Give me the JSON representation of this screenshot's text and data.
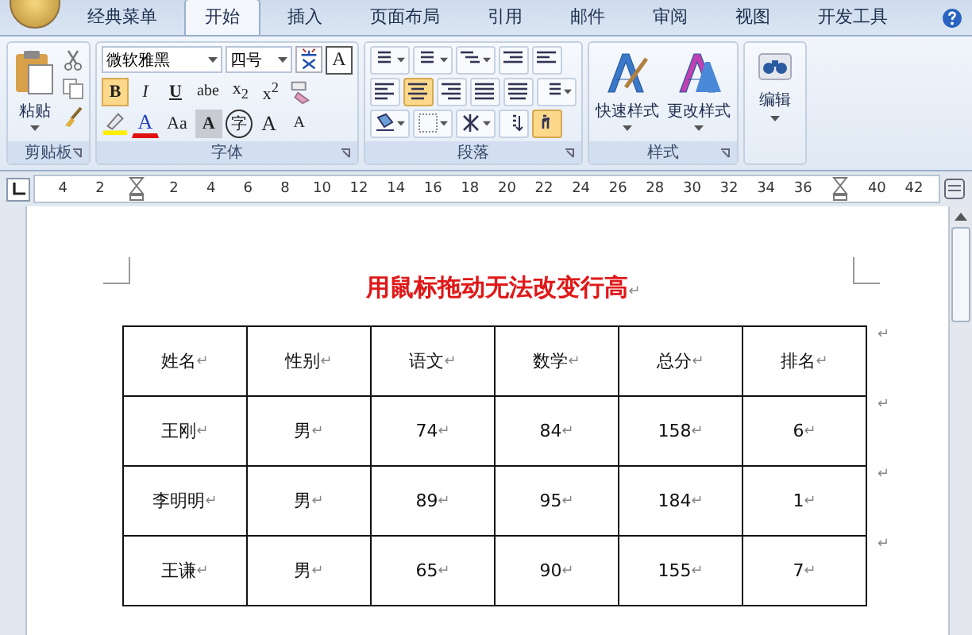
{
  "tabs": [
    {
      "label": "经典菜单",
      "selected": false
    },
    {
      "label": "开始",
      "selected": true
    },
    {
      "label": "插入",
      "selected": false
    },
    {
      "label": "页面布局",
      "selected": false
    },
    {
      "label": "引用",
      "selected": false
    },
    {
      "label": "邮件",
      "selected": false
    },
    {
      "label": "审阅",
      "selected": false
    },
    {
      "label": "视图",
      "selected": false
    },
    {
      "label": "开发工具",
      "selected": false
    }
  ],
  "clipboard": {
    "paste_label": "粘贴",
    "group_label": "剪贴板"
  },
  "font": {
    "font_name": "微软雅黑",
    "font_size": "四号",
    "group_label": "字体",
    "row1_buttons": [
      {
        "label": "A",
        "kind": "boxed"
      }
    ],
    "row2_buttons": [
      {
        "label": "B",
        "kind": "bold",
        "selected": true
      },
      {
        "label": "I",
        "kind": "italic",
        "selected": false
      },
      {
        "label": "U",
        "kind": "underline",
        "selected": false
      },
      {
        "label": "abe",
        "kind": "strike",
        "selected": false
      },
      {
        "label": "x$_{2}$",
        "kind": "plain",
        "selected": false
      },
      {
        "label": "x$^{2}$",
        "kind": "plain",
        "selected": false
      }
    ],
    "row3_buttons": [
      {
        "label": "A",
        "kind": "color",
        "selected": false
      },
      {
        "label": "Aa",
        "kind": "plain",
        "selected": false
      },
      {
        "label": "A",
        "kind": "shaded",
        "selected": false
      },
      {
        "label": "字",
        "kind": "circled",
        "selected": false
      },
      {
        "label": "A",
        "kind": "grow",
        "selected": false
      },
      {
        "label": "A",
        "kind": "shrink",
        "selected": false
      }
    ]
  },
  "paragraph": {
    "group_label": "段落",
    "rows": [
      [
        {
          "kind": "bullets",
          "selected": false
        },
        {
          "kind": "numbering",
          "selected": false
        },
        {
          "kind": "multilevel",
          "selected": false
        },
        {
          "kind": "outdent",
          "selected": false
        },
        {
          "kind": "indent",
          "selected": false
        }
      ],
      [
        {
          "kind": "align-left",
          "selected": false
        },
        {
          "kind": "align-center",
          "selected": true
        },
        {
          "kind": "align-right",
          "selected": false
        },
        {
          "kind": "justify",
          "selected": false
        },
        {
          "kind": "distributed",
          "selected": false
        },
        {
          "kind": "line-spacing",
          "selected": false
        }
      ],
      [
        {
          "kind": "shading",
          "selected": false
        },
        {
          "kind": "borders",
          "selected": false
        },
        {
          "kind": "asian-layout",
          "selected": false
        },
        {
          "kind": "sort",
          "selected": false
        },
        {
          "kind": "show-marks",
          "selected": true
        }
      ]
    ]
  },
  "styles": {
    "group_label": "样式",
    "buttons": [
      {
        "label": "快速样式"
      },
      {
        "label": "更改样式"
      }
    ]
  },
  "editing": {
    "label": "编辑"
  },
  "ruler": [
    {
      "kind": "number",
      "label": "4"
    },
    {
      "kind": "number",
      "label": "2"
    },
    {
      "kind": "marker"
    },
    {
      "kind": "number",
      "label": "2"
    },
    {
      "kind": "number",
      "label": "4"
    },
    {
      "kind": "number",
      "label": "6"
    },
    {
      "kind": "number",
      "label": "8"
    },
    {
      "kind": "number",
      "label": "10"
    },
    {
      "kind": "number",
      "label": "12"
    },
    {
      "kind": "number",
      "label": "14"
    },
    {
      "kind": "number",
      "label": "16"
    },
    {
      "kind": "number",
      "label": "18"
    },
    {
      "kind": "number",
      "label": "20"
    },
    {
      "kind": "number",
      "label": "22"
    },
    {
      "kind": "number",
      "label": "24"
    },
    {
      "kind": "number",
      "label": "26"
    },
    {
      "kind": "number",
      "label": "28"
    },
    {
      "kind": "number",
      "label": "30"
    },
    {
      "kind": "number",
      "label": "32"
    },
    {
      "kind": "number",
      "label": "34"
    },
    {
      "kind": "number",
      "label": "36"
    },
    {
      "kind": "marker"
    },
    {
      "kind": "number",
      "label": "40"
    },
    {
      "kind": "number",
      "label": "42"
    }
  ],
  "document": {
    "title": "用鼠标拖动无法改变行高",
    "title_mark": "↵",
    "table": {
      "columns": [
        "姓名",
        "性别",
        "语文",
        "数学",
        "总分",
        "排名"
      ],
      "rows": [
        [
          "王刚",
          "男",
          "74",
          "84",
          "158",
          "6"
        ],
        [
          "李明明",
          "男",
          "89",
          "95",
          "184",
          "1"
        ],
        [
          "王谦",
          "男",
          "65",
          "90",
          "155",
          "7"
        ]
      ]
    },
    "para_mark": "↵"
  }
}
